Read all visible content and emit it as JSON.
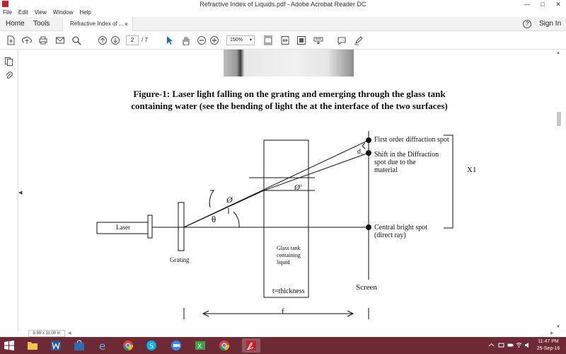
{
  "window": {
    "title": "Refractive Index of Liquids.pdf - Adobe Acrobat Reader DC",
    "minimize": "—",
    "maximize": "□",
    "close": "✕"
  },
  "menu": [
    "File",
    "Edit",
    "View",
    "Window",
    "Help"
  ],
  "tabs": {
    "home": "Home",
    "tools": "Tools",
    "document": "Refractive Index of ...",
    "close": "×",
    "help": "?",
    "sign_in": "Sign In"
  },
  "toolbar": {
    "icons": [
      "create-pdf-icon",
      "upload-icon",
      "print-icon",
      "email-icon",
      "search-icon",
      "page-up-icon",
      "page-down-icon",
      "select-arrow-icon",
      "hand-icon",
      "zoom-out-icon",
      "zoom-in-icon",
      "fit-page-icon",
      "fit-width-icon",
      "full-screen-icon",
      "keyboard-icon",
      "comment-icon",
      "highlight-pen-icon"
    ],
    "page_current": "2",
    "page_total": "/ 7",
    "zoom": "150%",
    "zoom_arrow": "▾"
  },
  "figure": {
    "caption_line1": "Figure-1: Laser light falling on the grating and emerging through the glass tank",
    "caption_line2": "containing water  (see the bending of light the at the interface of the two surfaces)",
    "laser": "Laser",
    "grating": "Grating",
    "glass_tank_1": "Glass tank",
    "glass_tank_2": "containing",
    "glass_tank_3": "liquid",
    "thickness": "t=thickness",
    "screen": "Screen",
    "first_order": "First order diffraction spot",
    "shift_1": "Shift in the Diffraction",
    "shift_2": "spot due to the",
    "shift_3": "material",
    "d_label": "d",
    "d_sub": "1",
    "x1": "X1",
    "central_1": "Central bright spot",
    "central_2": "(direct ray)",
    "phi": "Ø",
    "phi_prime": "Ø'",
    "theta": "θ",
    "f": "f"
  },
  "statusbar": {
    "page_size": "8.50 x 11.00 in"
  },
  "taskbar": {
    "apps": [
      "file-explorer-icon",
      "word-icon",
      "store-icon",
      "ie-icon",
      "chrome-icon",
      "skype-icon",
      "zoom-icon",
      "outlook-icon",
      "excel-icon",
      "chrome2-icon",
      "acrobat-icon"
    ],
    "active_app": "acrobat-icon",
    "time": "11:47 PM",
    "date": "25-Sep-16"
  },
  "colors": {
    "taskbar": "#6e2a34",
    "acrobat_red": "#c8202a",
    "tab_bg": "#f2f2f2"
  }
}
